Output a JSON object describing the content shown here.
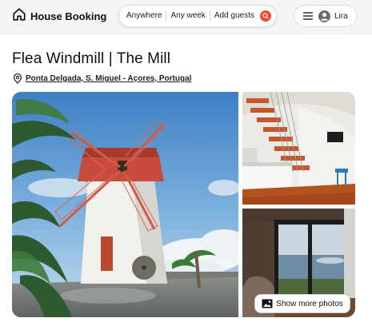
{
  "header": {
    "brand": "House Booking",
    "search": {
      "anywhere_label": "Anywhere",
      "week_label": "Any week",
      "guests_label": "Add guests"
    },
    "user_name": "Lira"
  },
  "listing": {
    "title": "Flea Windmill | The Mill",
    "location": "Ponta Delgada, S. Miguel - Açores, Portugal"
  },
  "gallery": {
    "show_more_label": "Show more photos"
  },
  "icons": {
    "logo": "home-icon",
    "search": "search-icon",
    "menu": "hamburger-menu-icon",
    "avatar": "user-avatar-icon",
    "location": "map-pin-icon",
    "photos": "image-icon"
  },
  "colors": {
    "accent": "#f04b2a",
    "header_bg": "#f5f5f5"
  }
}
